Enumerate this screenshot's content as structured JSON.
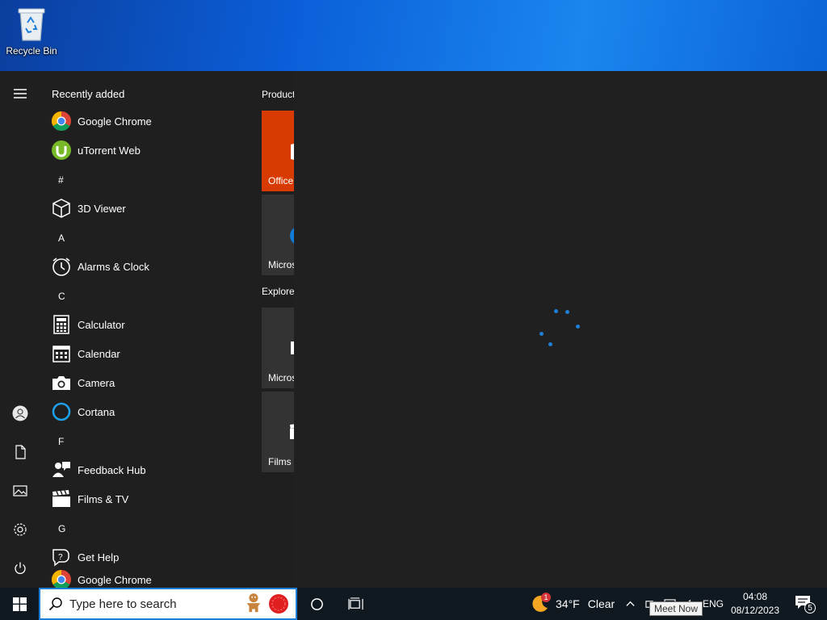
{
  "desktop": {
    "recycle_bin_label": "Recycle Bin"
  },
  "start_menu": {
    "recently_added_header": "Recently added",
    "recent_apps": [
      {
        "label": "Google Chrome",
        "icon": "chrome-icon"
      },
      {
        "label": "uTorrent Web",
        "icon": "utorrent-icon"
      }
    ],
    "sections": [
      {
        "letter": "#",
        "apps": [
          {
            "label": "3D Viewer",
            "icon": "cube-icon"
          }
        ]
      },
      {
        "letter": "A",
        "apps": [
          {
            "label": "Alarms & Clock",
            "icon": "alarm-clock-icon"
          }
        ]
      },
      {
        "letter": "C",
        "apps": [
          {
            "label": "Calculator",
            "icon": "calculator-icon"
          },
          {
            "label": "Calendar",
            "icon": "calendar-icon"
          },
          {
            "label": "Camera",
            "icon": "camera-icon"
          },
          {
            "label": "Cortana",
            "icon": "cortana-icon"
          }
        ]
      },
      {
        "letter": "F",
        "apps": [
          {
            "label": "Feedback Hub",
            "icon": "feedback-icon"
          },
          {
            "label": "Films & TV",
            "icon": "clapperboard-icon"
          }
        ]
      },
      {
        "letter": "G",
        "apps": [
          {
            "label": "Get Help",
            "icon": "help-icon"
          },
          {
            "label": "Google Chrome",
            "icon": "chrome-icon"
          }
        ]
      }
    ],
    "tile_groups": [
      {
        "title": "Productivity"
      },
      {
        "title": "Explore"
      }
    ],
    "tiles": [
      {
        "label": "Office",
        "color": "#d83b01"
      },
      {
        "label": "Microsoft Edge",
        "color": "#333333"
      },
      {
        "label": "Microsoft Store",
        "color": "#333333"
      },
      {
        "label": "Films & TV",
        "color": "#333333"
      }
    ]
  },
  "taskbar": {
    "search_placeholder": "Type here to search",
    "weather_temp": "34°F",
    "weather_condition": "Clear",
    "weather_badge": "1",
    "language": "ENG",
    "time": "04:08",
    "date": "08/12/2023",
    "notification_count": "5",
    "tooltip": "Meet Now"
  },
  "colors": {
    "accent": "#1e7fd8",
    "start_bg": "#1f1f1f",
    "taskbar_bg": "#101820",
    "office_tile": "#d83b01"
  }
}
